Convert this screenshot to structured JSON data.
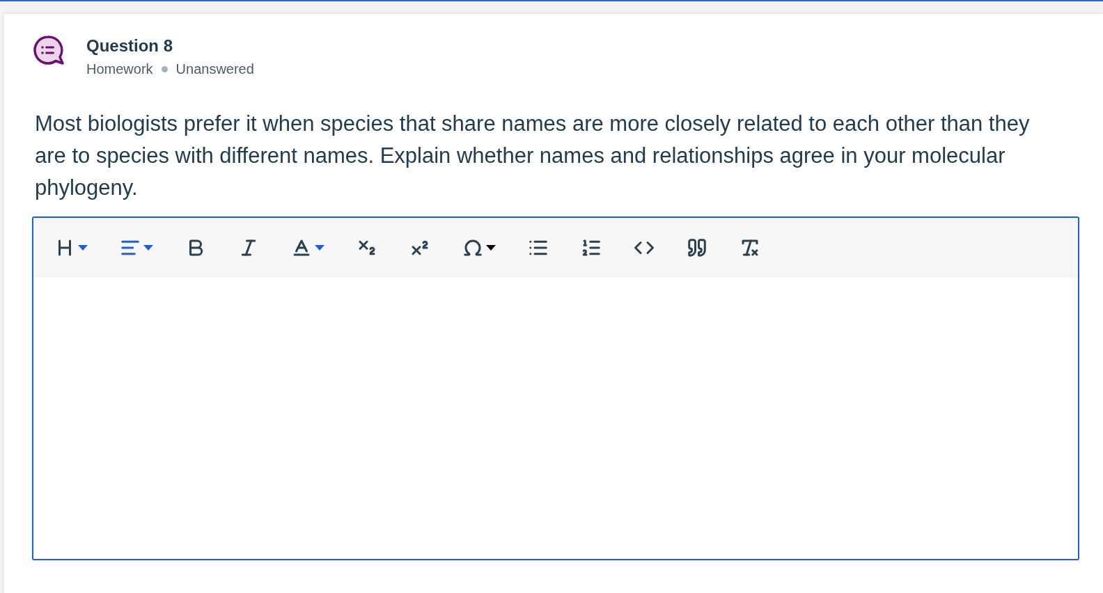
{
  "question": {
    "title": "Question 8",
    "meta": [
      "Homework",
      "Unanswered"
    ]
  },
  "prompt": "Most biologists prefer it when species that share names are more closely related to each other than they are to species with different names. Explain whether names and relationships agree in your molecular phylogeny.",
  "editor": {
    "toolbar": [
      {
        "kind": "heading",
        "dropdown": true
      },
      {
        "kind": "align",
        "dropdown": true
      },
      {
        "kind": "bold",
        "dropdown": false
      },
      {
        "kind": "italic",
        "dropdown": false
      },
      {
        "kind": "color",
        "dropdown": true
      },
      {
        "kind": "subscript",
        "dropdown": false
      },
      {
        "kind": "superscript",
        "dropdown": false
      },
      {
        "kind": "symbol",
        "dropdown": true
      },
      {
        "kind": "bullets",
        "dropdown": false
      },
      {
        "kind": "numbers",
        "dropdown": false
      },
      {
        "kind": "code",
        "dropdown": false
      },
      {
        "kind": "quote",
        "dropdown": false
      },
      {
        "kind": "clear",
        "dropdown": false
      }
    ]
  }
}
